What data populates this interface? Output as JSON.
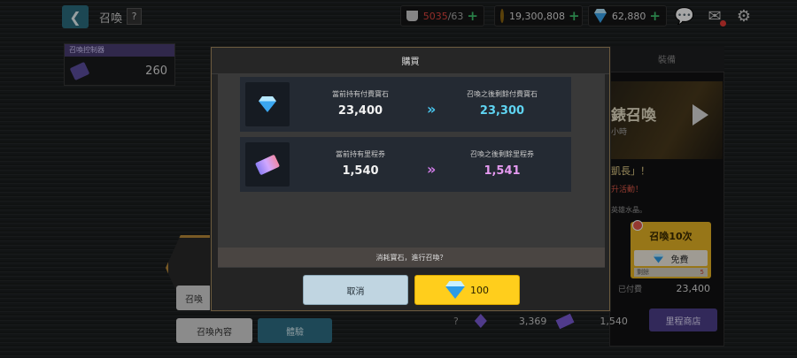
{
  "header": {
    "back_icon": "chevron-left-icon",
    "title": "召喚",
    "help": "?"
  },
  "resources": {
    "stamina_current": "5035",
    "stamina_max": "/63",
    "gold": "19,300,808",
    "gems": "62,880",
    "plus": "+"
  },
  "controller": {
    "title": "召喚控制器",
    "count": "260"
  },
  "right_panel": {
    "tab": "裝備",
    "banner_title": "錶召喚",
    "banner_sub": "小時",
    "event_line1": "凱長」！",
    "event_line2": "升活動！",
    "crystal": "英雄水晶。",
    "summon10_label": "召喚10次",
    "summon10_free": "免費",
    "summon10_remain": "剩餘",
    "summon10_remain_num": "5",
    "paid_label": "已付費",
    "paid_value": "23,400",
    "shop_btn": "里程商店",
    "help": "?"
  },
  "bottom_row": {
    "crystal_count": "3,369",
    "ticket_count": "1,540"
  },
  "left_buttons": {
    "summon": "召喚",
    "summon_content": "召喚內容",
    "other": "體驗"
  },
  "modal": {
    "title": "購買",
    "gem_row": {
      "current_label": "當前持有付費寶石",
      "current_value": "23,400",
      "after_label": "召喚之後剩餘付費寶石",
      "after_value": "23,300",
      "arrow": "»"
    },
    "ticket_row": {
      "current_label": "當前持有里程券",
      "current_value": "1,540",
      "after_label": "召喚之後剩餘里程券",
      "after_value": "1,541",
      "arrow": "»"
    },
    "prompt": "消耗寶石，進行召喚？",
    "cancel": "取消",
    "confirm_cost": "100"
  },
  "colors": {
    "gem_accent": "#48c6ee",
    "ticket_accent": "#d07be6",
    "confirm_yellow": "#ffce1c",
    "cancel_blue": "#c0d5e1"
  }
}
